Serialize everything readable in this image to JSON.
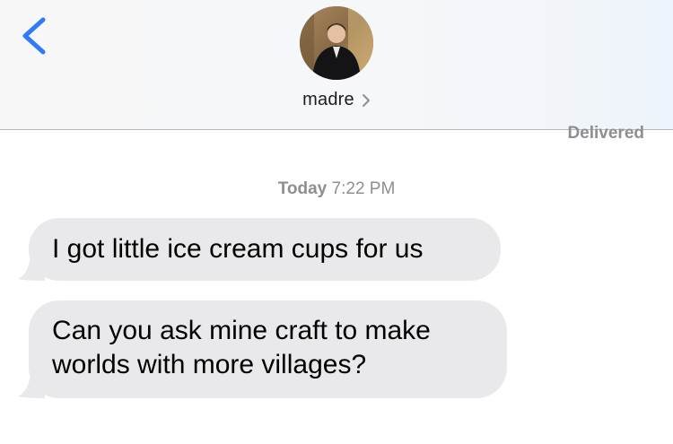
{
  "header": {
    "contact_name": "madre",
    "contact_chevron": ">"
  },
  "status": "Delivered",
  "timestamp": {
    "day": "Today",
    "time": "7:22 PM"
  },
  "messages": [
    {
      "text": "I got little ice cream cups for us"
    },
    {
      "line1": "Can you ask mine craft to make",
      "line2": "worlds with more villages?"
    }
  ],
  "colors": {
    "accent": "#2f7cf6",
    "bubble": "#e9e9eb",
    "meta_text": "#8e8e93"
  },
  "icons": {
    "back": "chevron-left-icon",
    "contact_disclosure": "chevron-right-icon"
  }
}
